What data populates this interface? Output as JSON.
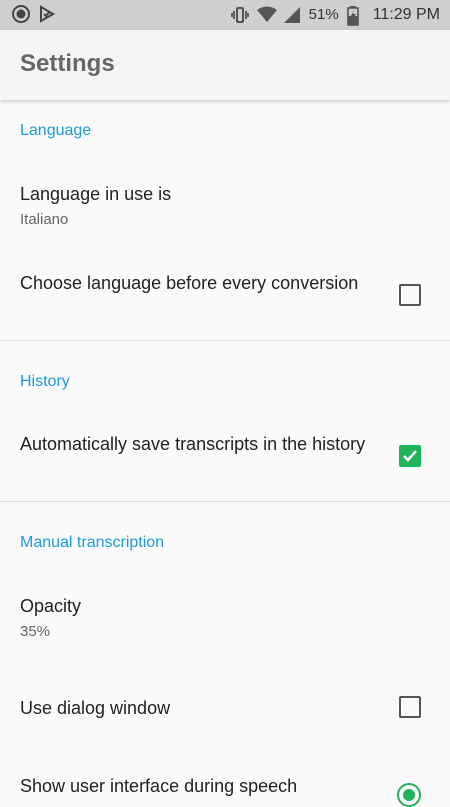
{
  "status_bar": {
    "battery_percent": "51%",
    "time": "11:29 PM"
  },
  "app_bar": {
    "title": "Settings"
  },
  "sections": {
    "language": {
      "title": "Language",
      "language_in_use": {
        "title": "Language in use is",
        "summary": "Italiano"
      },
      "choose_before_conversion": {
        "title": "Choose language before every conversion",
        "checked": false
      }
    },
    "history": {
      "title": "History",
      "auto_save": {
        "title": "Automatically save transcripts in the history",
        "checked": true
      }
    },
    "manual": {
      "title": "Manual transcription",
      "opacity": {
        "title": "Opacity",
        "summary": "35%"
      },
      "dialog_window": {
        "title": "Use dialog window",
        "checked": false
      },
      "show_ui": {
        "title": "Show user interface during speech",
        "selected": true
      }
    }
  },
  "colors": {
    "accent": "#1a9bdc",
    "check_green": "#1fb35a"
  }
}
